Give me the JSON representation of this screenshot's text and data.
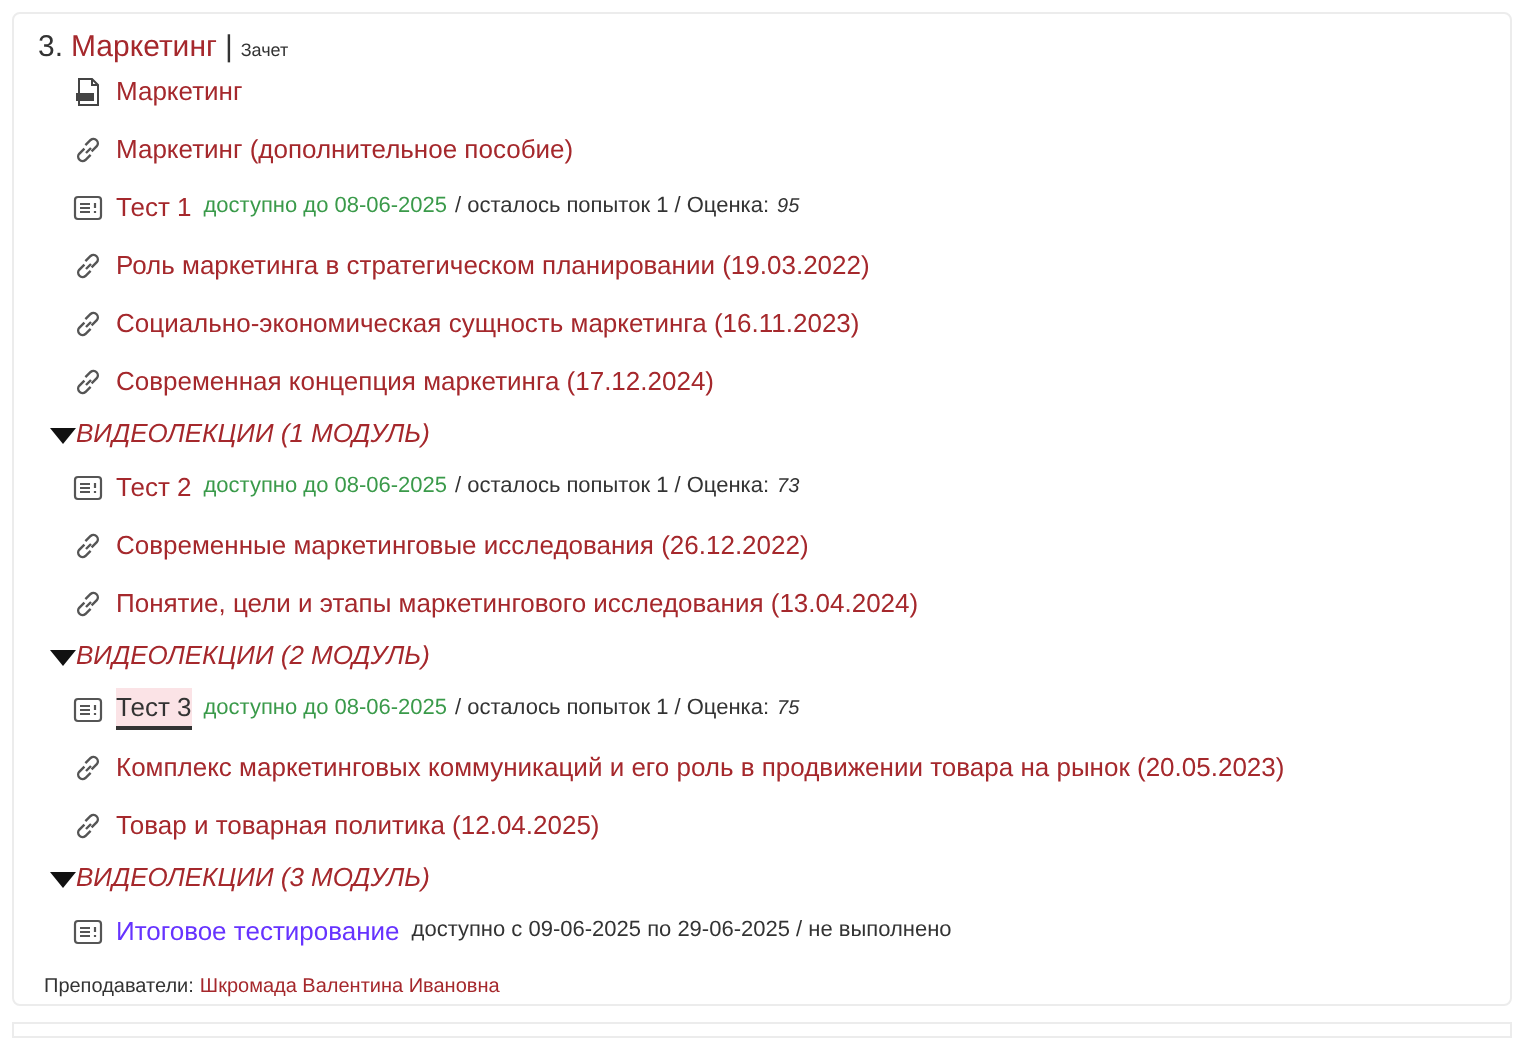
{
  "course": {
    "number": "3.",
    "title": "Маркетинг",
    "separator": "|",
    "credit": "Зачет",
    "items": [
      {
        "kind": "pdf",
        "title": "Маркетинг"
      },
      {
        "kind": "link",
        "title": "Маркетинг (дополнительное пособие)"
      },
      {
        "kind": "quiz",
        "title": "Тест 1",
        "availability": "доступно до 08-06-2025",
        "status": "/ осталось попыток 1 / Оценка:",
        "grade": "95",
        "focused": false
      },
      {
        "kind": "link",
        "title": "Роль маркетинга в стратегическом планировании (19.03.2022)"
      },
      {
        "kind": "link",
        "title": "Социально-экономическая сущность маркетинга (16.11.2023)"
      },
      {
        "kind": "link",
        "title": "Современная концепция маркетинга (17.12.2024)"
      }
    ],
    "sections": [
      {
        "title": "ВИДЕОЛЕКЦИИ (1 МОДУЛЬ)",
        "expanded": true,
        "items": [
          {
            "kind": "quiz",
            "title": "Тест 2",
            "availability": "доступно до 08-06-2025",
            "status": "/ осталось попыток 1 / Оценка:",
            "grade": "73",
            "focused": false
          },
          {
            "kind": "link",
            "title": "Современные маркетинговые исследования (26.12.2022)"
          },
          {
            "kind": "link",
            "title": "Понятие, цели и этапы маркетингового исследования (13.04.2024)"
          }
        ]
      },
      {
        "title": "ВИДЕОЛЕКЦИИ (2 МОДУЛЬ)",
        "expanded": true,
        "items": [
          {
            "kind": "quiz",
            "title": "Тест 3",
            "availability": "доступно до 08-06-2025",
            "status": "/ осталось попыток 1 / Оценка:",
            "grade": "75",
            "focused": true
          },
          {
            "kind": "link",
            "title": "Комплекс маркетинговых коммуникаций и его роль в продвижении товара на рынок (20.05.2023)"
          },
          {
            "kind": "link",
            "title": "Товар и товарная политика (12.04.2025)"
          }
        ]
      },
      {
        "title": "ВИДЕОЛЕКЦИИ (3 МОДУЛЬ)",
        "expanded": true,
        "items": [
          {
            "kind": "final",
            "title": "Итоговое тестирование",
            "availability": "доступно с 09-06-2025 по 29-06-2025 / не выполнено"
          }
        ]
      }
    ],
    "teachers_label": "Преподаватели:",
    "teachers": "Шкромада Валентина Ивановна"
  }
}
